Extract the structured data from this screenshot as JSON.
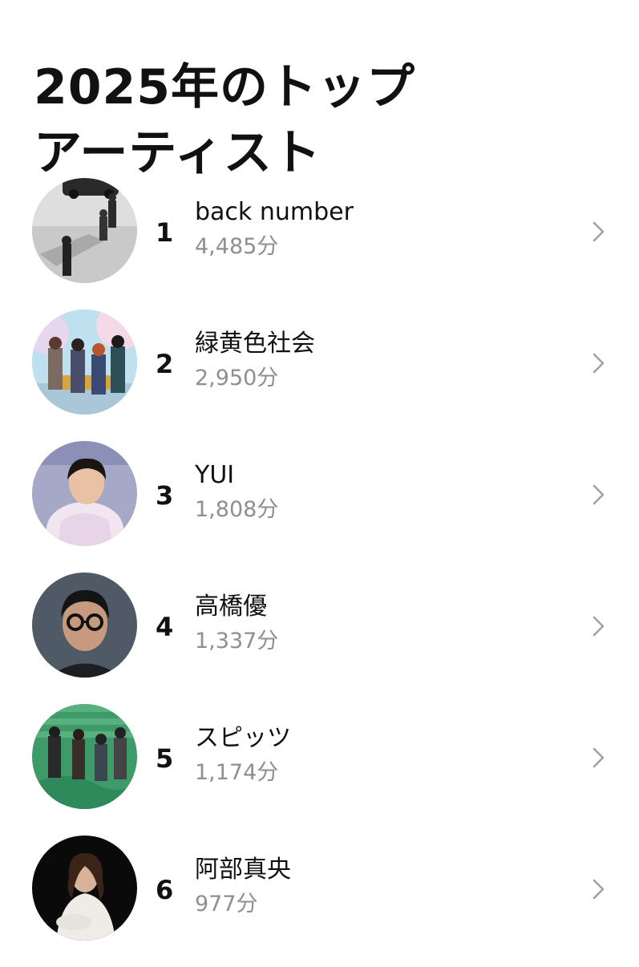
{
  "header": {
    "title_line1": "2025年のトップ",
    "title_line2": "アーティスト"
  },
  "artists": [
    {
      "rank": "1",
      "name": "back number",
      "minutes": "4,485分"
    },
    {
      "rank": "2",
      "name": "緑黄色社会",
      "minutes": "2,950分"
    },
    {
      "rank": "3",
      "name": "YUI",
      "minutes": "1,808分"
    },
    {
      "rank": "4",
      "name": "高橋優",
      "minutes": "1,337分"
    },
    {
      "rank": "5",
      "name": "スピッツ",
      "minutes": "1,174分"
    },
    {
      "rank": "6",
      "name": "阿部真央",
      "minutes": "977分"
    }
  ],
  "colors": {
    "text_primary": "#111111",
    "text_secondary": "#8e8e93",
    "chevron": "#a0a0a5",
    "background": "#ffffff"
  },
  "icons": {
    "row_chevron": "chevron-right-icon"
  }
}
